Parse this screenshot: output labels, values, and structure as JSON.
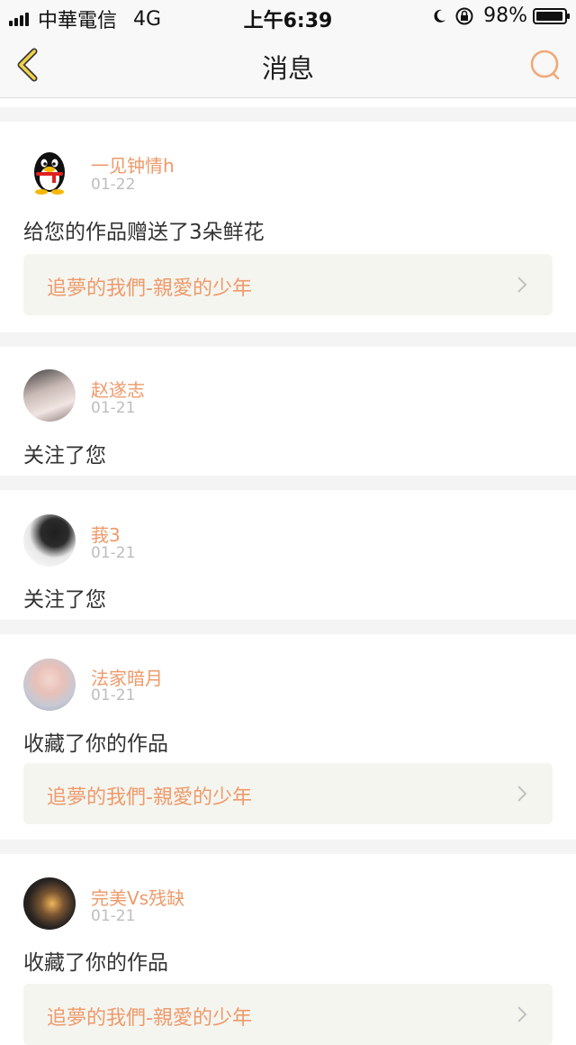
{
  "status_bar": {
    "carrier": "中華電信",
    "network": "4G",
    "time": "上午6:39",
    "battery_pct": "98%",
    "battery_level": 0.98
  },
  "nav": {
    "title": "消息",
    "back_icon": "chevron-left-icon",
    "search_icon": "search-icon",
    "accent_color": "#ee9a6a"
  },
  "messages": [
    {
      "user": "一见钟情h",
      "date": "01-22",
      "action": "给您的作品赠送了3朵鲜花",
      "work": "追夢的我們-親愛的少年"
    },
    {
      "user": "赵遂志",
      "date": "01-21",
      "action": "关注了您"
    },
    {
      "user": "莪3",
      "date": "01-21",
      "action": "关注了您"
    },
    {
      "user": "法家暗月",
      "date": "01-21",
      "action": "收藏了你的作品",
      "work": "追夢的我們-親愛的少年"
    },
    {
      "user": "完美Vs残缺",
      "date": "01-21",
      "action": "收藏了你的作品",
      "work": "追夢的我們-親愛的少年"
    }
  ]
}
